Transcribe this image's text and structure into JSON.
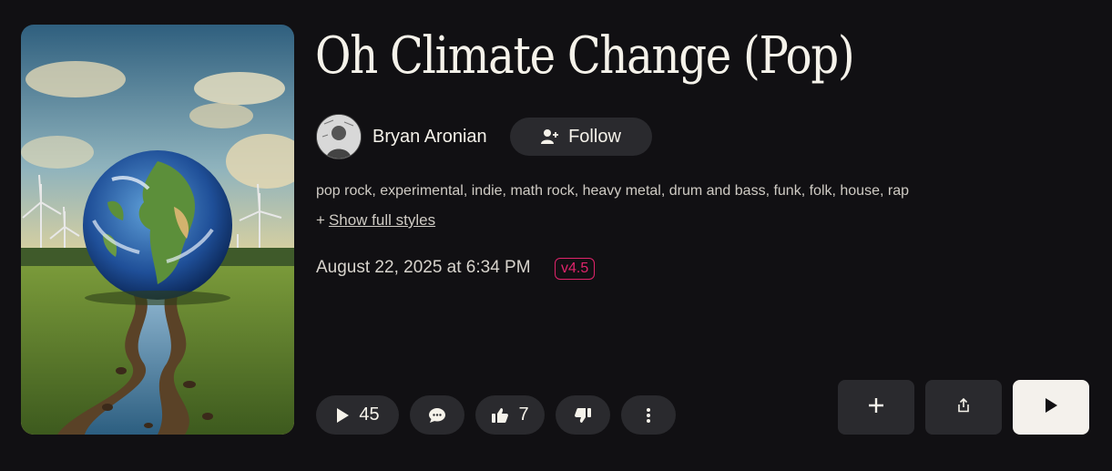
{
  "song": {
    "title": "Oh Climate Change (Pop)",
    "artist": "Bryan Aronian",
    "styles": "pop rock, experimental, indie, math rock, heavy metal, drum and bass, funk, folk, house, rap",
    "show_styles_prefix": "+",
    "show_styles_label": "Show full styles",
    "date": "August 22, 2025 at 6:34 PM",
    "version": "v4.5"
  },
  "follow": {
    "label": "Follow",
    "icon": "add-user-icon"
  },
  "stats": {
    "plays": "45",
    "likes": "7"
  },
  "icons": {
    "plays": "play-icon",
    "comments": "comment-icon",
    "likes": "thumbs-up-icon",
    "dislikes": "thumbs-down-icon",
    "more": "more-vertical-icon",
    "add": "plus-icon",
    "share": "share-icon",
    "play": "play-icon"
  },
  "colors": {
    "background": "#111013",
    "pill": "#2a2a2e",
    "version_accent": "#e0246b",
    "play_button": "#f4f1ec"
  }
}
